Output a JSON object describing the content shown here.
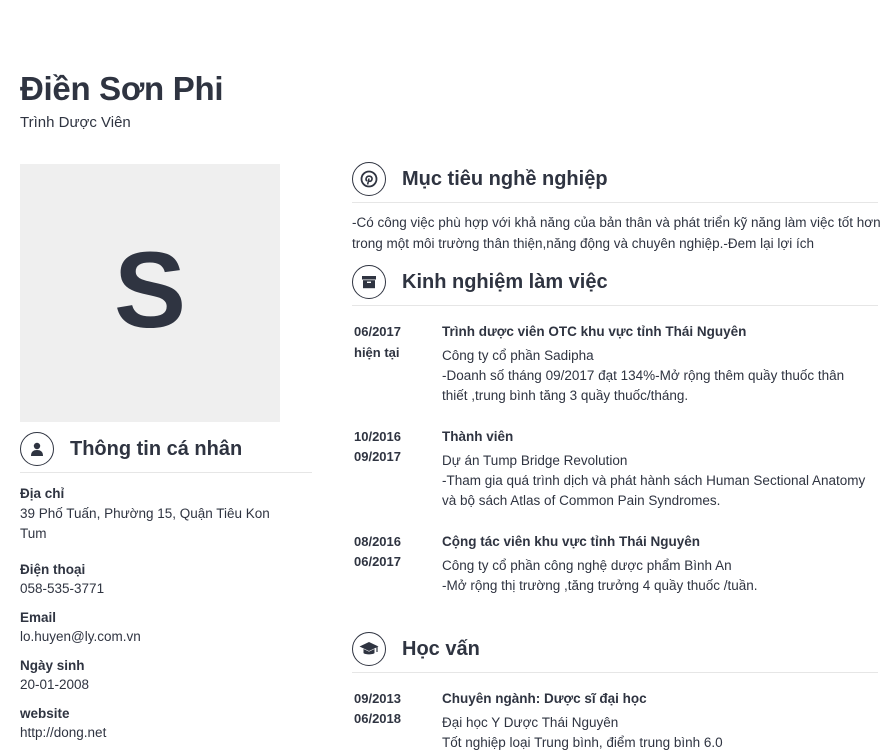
{
  "header": {
    "name": "Điền Sơn Phi",
    "job_title": "Trình Dược Viên"
  },
  "avatar": {
    "initial": "S"
  },
  "personal": {
    "title": "Thông tin cá nhân",
    "fields": [
      {
        "label": "Địa chỉ",
        "value": "39 Phố Tuấn, Phường 15, Quận Tiêu Kon Tum"
      },
      {
        "label": "Điện thoại",
        "value": "058-535-3771"
      },
      {
        "label": "Email",
        "value": "lo.huyen@ly.com.vn"
      },
      {
        "label": "Ngày sinh",
        "value": "20-01-2008"
      },
      {
        "label": "website",
        "value": "http://dong.net"
      }
    ]
  },
  "objective": {
    "title": "Mục tiêu nghề nghiệp",
    "text": "-Có công việc phù hợp với khả năng của bản thân và phát triển kỹ năng làm việc tốt hơn trong một môi trường thân thiện,năng động và chuyên nghiệp.-Đem lại lợi ích"
  },
  "experience": {
    "title": "Kinh nghiệm làm việc",
    "items": [
      {
        "from": "06/2017",
        "to": "hiện tại",
        "title": "Trình dược viên OTC khu vực tỉnh Thái Nguyên",
        "org": "Công ty cổ phần Sadipha",
        "detail": "-Doanh số tháng 09/2017 đạt 134%-Mở rộng thêm quầy thuốc thân thiết ,trung bình tăng 3 quầy thuốc/tháng."
      },
      {
        "from": "10/2016",
        "to": "09/2017",
        "title": "Thành viên",
        "org": "Dự án Tump Bridge Revolution",
        "detail": "-Tham gia quá trình dịch và phát hành sách Human Sectional Anatomy và bộ sách Atlas of Common Pain Syndromes."
      },
      {
        "from": "08/2016",
        "to": "06/2017",
        "title": "Cộng tác viên khu vực tỉnh Thái Nguyên",
        "org": "Công ty cổ phần công nghệ dược phẩm Bình An",
        "detail": "-Mở rộng thị trường ,tăng trưởng 4 quầy thuốc /tuần."
      }
    ]
  },
  "education": {
    "title": "Học vấn",
    "items": [
      {
        "from": "09/2013",
        "to": "06/2018",
        "title": "Chuyên ngành: Dược sĩ đại học",
        "org": "Đại học Y Dược Thái Nguyên",
        "detail": "Tốt nghiệp loại Trung bình, điểm trung bình 6.0"
      }
    ]
  },
  "icons": {
    "personal": "person-icon",
    "objective": "pinterest-icon",
    "experience": "archive-box-icon",
    "education": "graduation-cap-icon"
  }
}
